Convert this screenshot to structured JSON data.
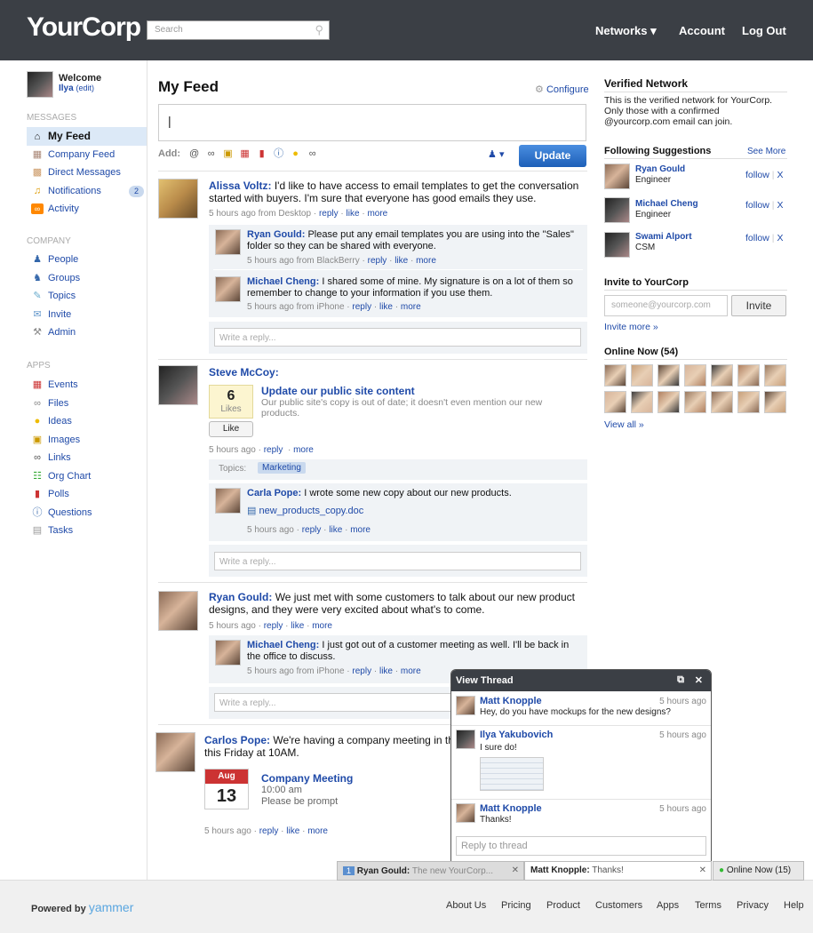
{
  "header": {
    "logo": "YourCorp",
    "search_placeholder": "Search",
    "nav": [
      "Networks ▾",
      "Account",
      "Log Out"
    ]
  },
  "sidebar": {
    "welcome": "Welcome",
    "user": "Ilya",
    "edit": "(edit)",
    "messages_title": "MESSAGES",
    "messages": [
      {
        "label": "My Feed",
        "icon": "home-icon",
        "active": true
      },
      {
        "label": "Company Feed",
        "icon": "building-icon"
      },
      {
        "label": "Direct Messages",
        "icon": "mail-icon"
      },
      {
        "label": "Notifications",
        "icon": "bell-icon",
        "badge": "2"
      },
      {
        "label": "Activity",
        "icon": "rss-icon"
      }
    ],
    "company_title": "COMPANY",
    "company": [
      {
        "label": "People",
        "icon": "person-icon"
      },
      {
        "label": "Groups",
        "icon": "group-icon"
      },
      {
        "label": "Topics",
        "icon": "tag-icon"
      },
      {
        "label": "Invite",
        "icon": "invite-icon"
      },
      {
        "label": "Admin",
        "icon": "wrench-icon"
      }
    ],
    "apps_title": "APPS",
    "apps": [
      {
        "label": "Events",
        "icon": "calendar-icon"
      },
      {
        "label": "Files",
        "icon": "paperclip-icon"
      },
      {
        "label": "Ideas",
        "icon": "lightbulb-icon"
      },
      {
        "label": "Images",
        "icon": "image-icon"
      },
      {
        "label": "Links",
        "icon": "link-icon"
      },
      {
        "label": "Org Chart",
        "icon": "org-chart-icon"
      },
      {
        "label": "Polls",
        "icon": "poll-icon"
      },
      {
        "label": "Questions",
        "icon": "question-icon"
      },
      {
        "label": "Tasks",
        "icon": "task-icon"
      }
    ]
  },
  "feed": {
    "title": "My Feed",
    "configure": "Configure",
    "compose_value": "|",
    "add_label": "Add:",
    "update": "Update",
    "write_reply": "Write a reply...",
    "posts": [
      {
        "author": "Alissa Voltz:",
        "text": "I'd like to have access to email templates to get the conversation started with buyers. I'm sure that everyone has good emails they use.",
        "meta": "5 hours ago from Desktop ·",
        "reply": "reply",
        "like": "like",
        "more": "more",
        "replies": [
          {
            "author": "Ryan Gould:",
            "text": "Please put any email templates you are using into the \"Sales\" folder so they can be shared with everyone.",
            "meta": "5 hours ago from BlackBerry ·"
          },
          {
            "author": "Michael Cheng:",
            "text": "I shared some of mine. My signature is on a lot of them so remember to change to your information if you use them.",
            "meta": "5 hours ago from iPhone ·"
          }
        ]
      },
      {
        "author": "Steve McCoy:",
        "likes_count": "6",
        "likes_label": "Likes",
        "like_btn": "Like",
        "link_title": "Update our public site content",
        "link_desc": "Our public site's copy is out of date; it doesn't even mention our new products.",
        "meta": "5 hours ago ·",
        "topics_label": "Topics:",
        "topic": "Marketing",
        "replies": [
          {
            "author": "Carla Pope:",
            "text": "I wrote some new copy about our new products.",
            "file": "new_products_copy.doc",
            "meta": "5 hours ago ·"
          }
        ]
      },
      {
        "author": "Ryan Gould:",
        "text": "We just met with some customers to talk about our new product designs, and they were very excited about what's to come.",
        "meta": "5 hours ago ·",
        "replies": [
          {
            "author": "Michael Cheng:",
            "text": "I just got out of a customer meeting as well. I'll be back in the office to discuss.",
            "meta": "5 hours ago from iPhone ·"
          }
        ]
      },
      {
        "author": "Carlos Pope:",
        "text": "We're having a company meeting in th",
        "text2": "this Friday at 10AM.",
        "cal_month": "Aug",
        "cal_day": "13",
        "event_title": "Company Meeting",
        "event_time": "10:00 am",
        "event_desc": "Please be prompt",
        "meta": "5 hours ago ·"
      }
    ]
  },
  "right": {
    "verified_title": "Verified Network",
    "verified_text": "This is the verified network for YourCorp. Only those with a confirmed @yourcorp.com email can join.",
    "suggest_title": "Following Suggestions",
    "see_more": "See More",
    "follow": "follow",
    "x": "X",
    "suggestions": [
      {
        "name": "Ryan Gould",
        "role": "Engineer"
      },
      {
        "name": "Michael Cheng",
        "role": "Engineer"
      },
      {
        "name": "Swami Alport",
        "role": "CSM"
      }
    ],
    "invite_title": "Invite to YourCorp",
    "invite_placeholder": "someone@yourcorp.com",
    "invite_btn": "Invite",
    "invite_more": "Invite more »",
    "online_title": "Online Now (54)",
    "view_all": "View all »"
  },
  "thread": {
    "title": "View Thread",
    "messages": [
      {
        "author": "Matt Knopple",
        "time": "5 hours ago",
        "text": "Hey, do you have mockups for the new designs?"
      },
      {
        "author": "Ilya Yakubovich",
        "time": "5 hours ago",
        "text": "I sure do!"
      },
      {
        "author": "Matt Knopple",
        "time": "5 hours ago",
        "text": "Thanks!"
      }
    ],
    "reply_placeholder": "Reply to thread"
  },
  "chatbar": {
    "tab1_count": "1",
    "tab1_name": "Ryan Gould:",
    "tab1_text": " The new YourCorp...",
    "tab2_name": "Matt Knopple:",
    "tab2_text": " Thanks!",
    "online": "Online Now (15)"
  },
  "footer": {
    "powered": "Powered by",
    "brand": "yammer",
    "links": [
      "About Us",
      "Pricing",
      "Product",
      "Customers",
      "Apps",
      "Terms",
      "Privacy",
      "Help"
    ]
  }
}
